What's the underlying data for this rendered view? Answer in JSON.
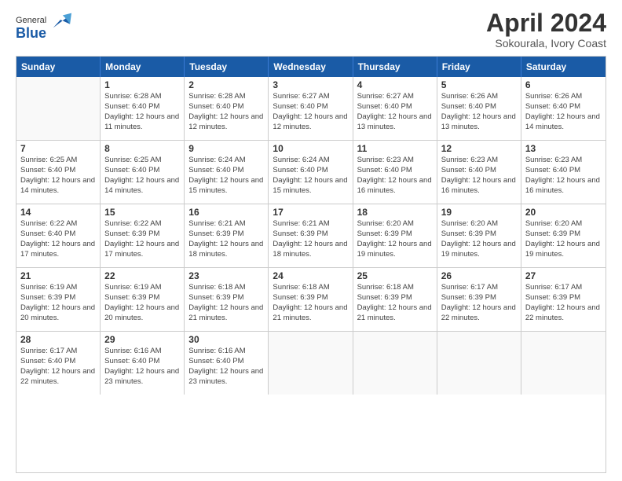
{
  "header": {
    "logo": {
      "general": "General",
      "blue": "Blue"
    },
    "title": "April 2024",
    "subtitle": "Sokourala, Ivory Coast"
  },
  "calendar": {
    "days_of_week": [
      "Sunday",
      "Monday",
      "Tuesday",
      "Wednesday",
      "Thursday",
      "Friday",
      "Saturday"
    ],
    "weeks": [
      [
        {
          "day": "",
          "sunrise": "",
          "sunset": "",
          "daylight": ""
        },
        {
          "day": "1",
          "sunrise": "6:28 AM",
          "sunset": "6:40 PM",
          "daylight": "12 hours and 11 minutes."
        },
        {
          "day": "2",
          "sunrise": "6:28 AM",
          "sunset": "6:40 PM",
          "daylight": "12 hours and 12 minutes."
        },
        {
          "day": "3",
          "sunrise": "6:27 AM",
          "sunset": "6:40 PM",
          "daylight": "12 hours and 12 minutes."
        },
        {
          "day": "4",
          "sunrise": "6:27 AM",
          "sunset": "6:40 PM",
          "daylight": "12 hours and 13 minutes."
        },
        {
          "day": "5",
          "sunrise": "6:26 AM",
          "sunset": "6:40 PM",
          "daylight": "12 hours and 13 minutes."
        },
        {
          "day": "6",
          "sunrise": "6:26 AM",
          "sunset": "6:40 PM",
          "daylight": "12 hours and 14 minutes."
        }
      ],
      [
        {
          "day": "7",
          "sunrise": "6:25 AM",
          "sunset": "6:40 PM",
          "daylight": "12 hours and 14 minutes."
        },
        {
          "day": "8",
          "sunrise": "6:25 AM",
          "sunset": "6:40 PM",
          "daylight": "12 hours and 14 minutes."
        },
        {
          "day": "9",
          "sunrise": "6:24 AM",
          "sunset": "6:40 PM",
          "daylight": "12 hours and 15 minutes."
        },
        {
          "day": "10",
          "sunrise": "6:24 AM",
          "sunset": "6:40 PM",
          "daylight": "12 hours and 15 minutes."
        },
        {
          "day": "11",
          "sunrise": "6:23 AM",
          "sunset": "6:40 PM",
          "daylight": "12 hours and 16 minutes."
        },
        {
          "day": "12",
          "sunrise": "6:23 AM",
          "sunset": "6:40 PM",
          "daylight": "12 hours and 16 minutes."
        },
        {
          "day": "13",
          "sunrise": "6:23 AM",
          "sunset": "6:40 PM",
          "daylight": "12 hours and 16 minutes."
        }
      ],
      [
        {
          "day": "14",
          "sunrise": "6:22 AM",
          "sunset": "6:40 PM",
          "daylight": "12 hours and 17 minutes."
        },
        {
          "day": "15",
          "sunrise": "6:22 AM",
          "sunset": "6:39 PM",
          "daylight": "12 hours and 17 minutes."
        },
        {
          "day": "16",
          "sunrise": "6:21 AM",
          "sunset": "6:39 PM",
          "daylight": "12 hours and 18 minutes."
        },
        {
          "day": "17",
          "sunrise": "6:21 AM",
          "sunset": "6:39 PM",
          "daylight": "12 hours and 18 minutes."
        },
        {
          "day": "18",
          "sunrise": "6:20 AM",
          "sunset": "6:39 PM",
          "daylight": "12 hours and 19 minutes."
        },
        {
          "day": "19",
          "sunrise": "6:20 AM",
          "sunset": "6:39 PM",
          "daylight": "12 hours and 19 minutes."
        },
        {
          "day": "20",
          "sunrise": "6:20 AM",
          "sunset": "6:39 PM",
          "daylight": "12 hours and 19 minutes."
        }
      ],
      [
        {
          "day": "21",
          "sunrise": "6:19 AM",
          "sunset": "6:39 PM",
          "daylight": "12 hours and 20 minutes."
        },
        {
          "day": "22",
          "sunrise": "6:19 AM",
          "sunset": "6:39 PM",
          "daylight": "12 hours and 20 minutes."
        },
        {
          "day": "23",
          "sunrise": "6:18 AM",
          "sunset": "6:39 PM",
          "daylight": "12 hours and 21 minutes."
        },
        {
          "day": "24",
          "sunrise": "6:18 AM",
          "sunset": "6:39 PM",
          "daylight": "12 hours and 21 minutes."
        },
        {
          "day": "25",
          "sunrise": "6:18 AM",
          "sunset": "6:39 PM",
          "daylight": "12 hours and 21 minutes."
        },
        {
          "day": "26",
          "sunrise": "6:17 AM",
          "sunset": "6:39 PM",
          "daylight": "12 hours and 22 minutes."
        },
        {
          "day": "27",
          "sunrise": "6:17 AM",
          "sunset": "6:39 PM",
          "daylight": "12 hours and 22 minutes."
        }
      ],
      [
        {
          "day": "28",
          "sunrise": "6:17 AM",
          "sunset": "6:40 PM",
          "daylight": "12 hours and 22 minutes."
        },
        {
          "day": "29",
          "sunrise": "6:16 AM",
          "sunset": "6:40 PM",
          "daylight": "12 hours and 23 minutes."
        },
        {
          "day": "30",
          "sunrise": "6:16 AM",
          "sunset": "6:40 PM",
          "daylight": "12 hours and 23 minutes."
        },
        {
          "day": "",
          "sunrise": "",
          "sunset": "",
          "daylight": ""
        },
        {
          "day": "",
          "sunrise": "",
          "sunset": "",
          "daylight": ""
        },
        {
          "day": "",
          "sunrise": "",
          "sunset": "",
          "daylight": ""
        },
        {
          "day": "",
          "sunrise": "",
          "sunset": "",
          "daylight": ""
        }
      ]
    ]
  }
}
